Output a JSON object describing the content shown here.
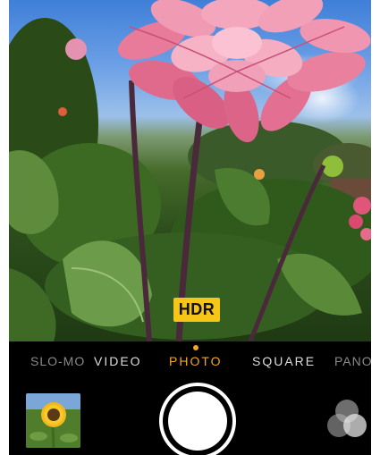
{
  "camera": {
    "hdr_label": "HDR",
    "hdr_color": "#f5c518",
    "active_mode_color": "#f5a623",
    "modes": [
      {
        "label": "SLO-MO",
        "active": false
      },
      {
        "label": "VIDEO",
        "active": false
      },
      {
        "label": "PHOTO",
        "active": true
      },
      {
        "label": "SQUARE",
        "active": false
      },
      {
        "label": "PANO",
        "active": false
      }
    ],
    "icons": {
      "shutter": "shutter-button-icon",
      "filters": "filters-icon",
      "last_photo": "sunflower-thumbnail"
    }
  }
}
